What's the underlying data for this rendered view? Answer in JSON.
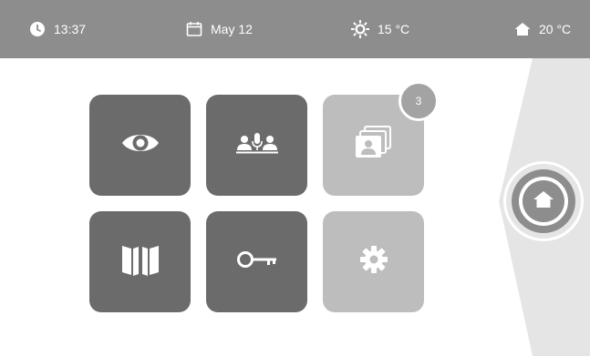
{
  "status_bar": {
    "time": "13:37",
    "date": "May 12",
    "outdoor_temp": "15 °C",
    "indoor_temp": "20 °C",
    "icons": [
      "clock-icon",
      "calendar-icon",
      "sun-icon",
      "house-icon"
    ]
  },
  "tiles": [
    {
      "name": "monitor",
      "icon": "eye-icon",
      "style": "dark"
    },
    {
      "name": "intercom",
      "icon": "users-microphone-icon",
      "style": "dark"
    },
    {
      "name": "gallery",
      "icon": "photos-icon",
      "style": "light",
      "badge": "3"
    },
    {
      "name": "phonebook",
      "icon": "book-icon",
      "style": "dark"
    },
    {
      "name": "door-unlock",
      "icon": "key-icon",
      "style": "dark"
    },
    {
      "name": "settings",
      "icon": "gear-icon",
      "style": "light"
    }
  ],
  "gallery_badge": "3",
  "home_button": {
    "icon": "home-icon"
  },
  "colors": {
    "status_bar": "#8d8d8d",
    "tile_dark": "#6b6b6b",
    "tile_light": "#bdbdbd",
    "side_panel": "#e5e5e5",
    "background": "#ffffff"
  }
}
